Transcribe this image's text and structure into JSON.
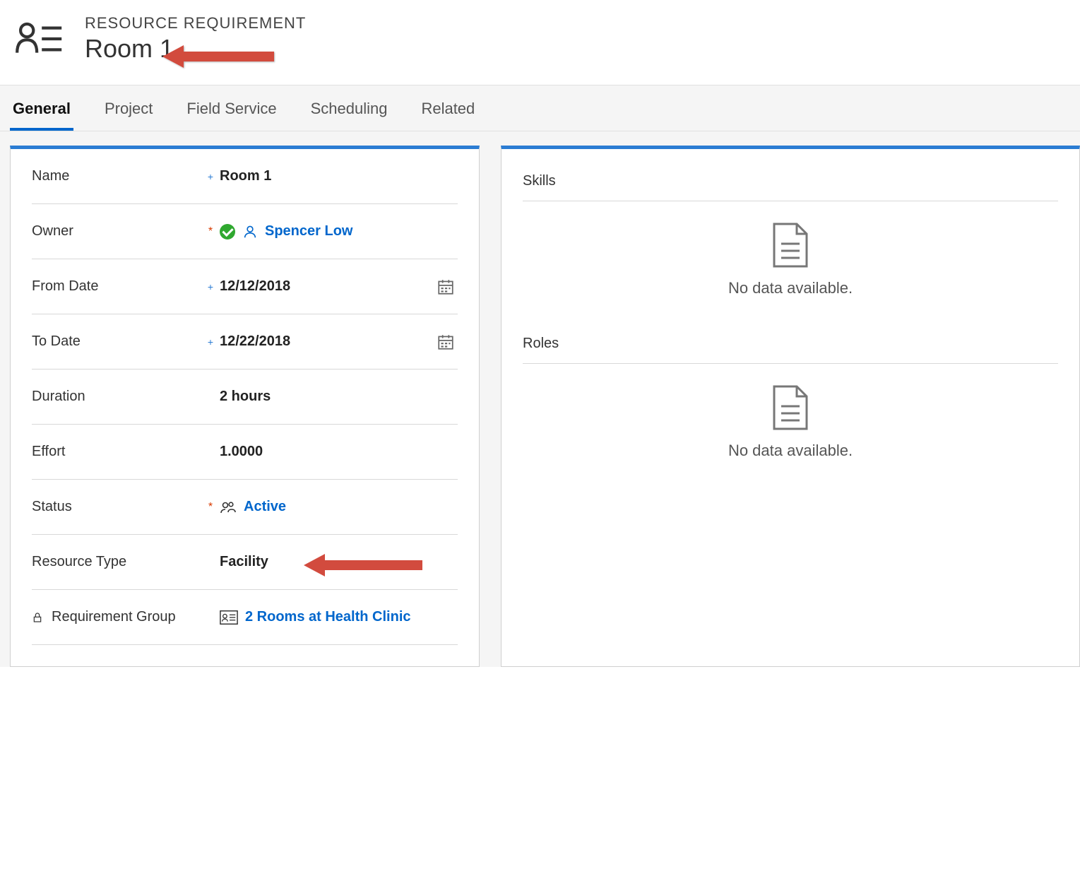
{
  "header": {
    "entity_label": "RESOURCE REQUIREMENT",
    "title": "Room 1"
  },
  "tabs": [
    {
      "label": "General",
      "active": true
    },
    {
      "label": "Project",
      "active": false
    },
    {
      "label": "Field Service",
      "active": false
    },
    {
      "label": "Scheduling",
      "active": false
    },
    {
      "label": "Related",
      "active": false
    }
  ],
  "fields": {
    "name": {
      "label": "Name",
      "value": "Room 1"
    },
    "owner": {
      "label": "Owner",
      "value": "Spencer Low"
    },
    "from_date": {
      "label": "From Date",
      "value": "12/12/2018"
    },
    "to_date": {
      "label": "To Date",
      "value": "12/22/2018"
    },
    "duration": {
      "label": "Duration",
      "value": "2 hours"
    },
    "effort": {
      "label": "Effort",
      "value": "1.0000"
    },
    "status": {
      "label": "Status",
      "value": "Active"
    },
    "resource_type": {
      "label": "Resource Type",
      "value": "Facility"
    },
    "requirement_group": {
      "label": "Requirement Group",
      "value": "2 Rooms at Health Clinic"
    }
  },
  "right": {
    "skills_heading": "Skills",
    "roles_heading": "Roles",
    "empty_text": "No data available."
  }
}
